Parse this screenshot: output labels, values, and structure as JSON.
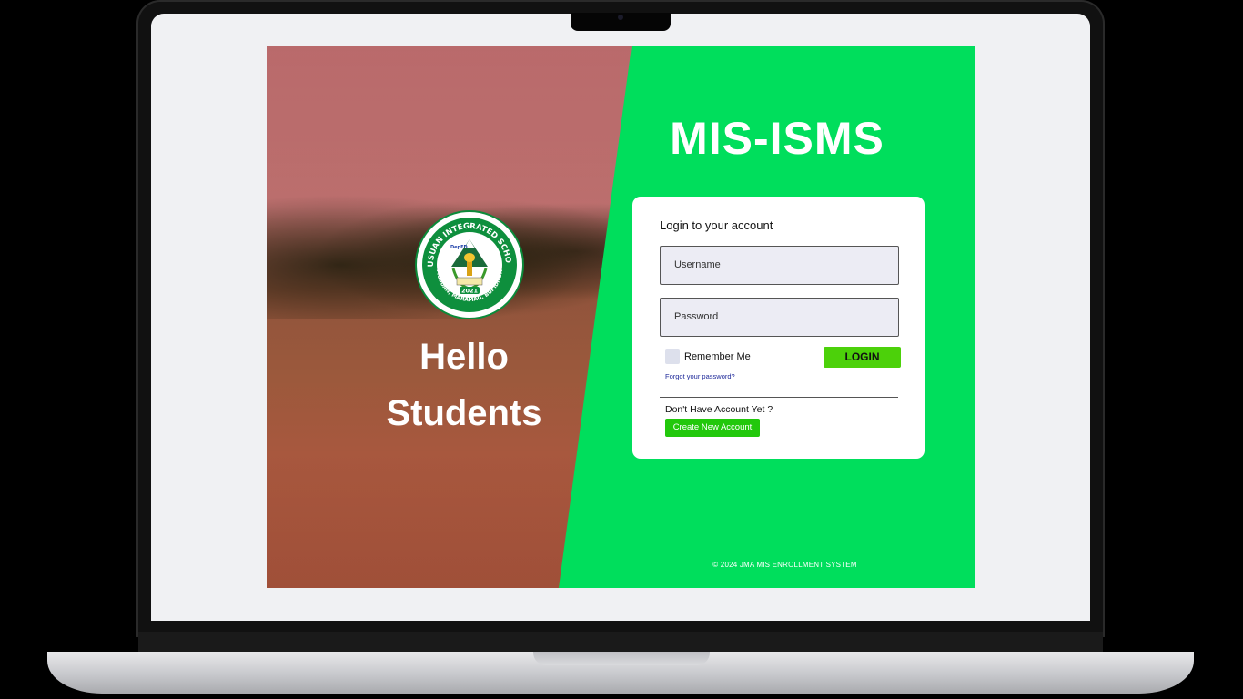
{
  "hero": {
    "greeting_line1": "Hello",
    "greeting_line2": "Students",
    "logo": {
      "name": "MUSUAN INTEGRATED SCHOOL",
      "subtitle": "MUSUAN, MARAMAG, BUKIDNON",
      "year": "2021",
      "badge": "DepED"
    }
  },
  "brand": {
    "title": "MIS-ISMS"
  },
  "login": {
    "heading": "Login to your account",
    "username_placeholder": "Username",
    "password_placeholder": "Password",
    "remember_label": "Remember Me",
    "login_button": "LOGIN",
    "forgot_link": "Forgot your password?",
    "no_account_text": "Don't Have Account Yet ?",
    "create_button": "Create New Account"
  },
  "footer": {
    "copyright": "© 2024 JMA MIS ENROLLMENT SYSTEM"
  },
  "colors": {
    "green_panel": "#00de5c",
    "login_button": "#4cd10a",
    "create_button": "#22c80c",
    "hero_overlay": "#dc5050"
  }
}
